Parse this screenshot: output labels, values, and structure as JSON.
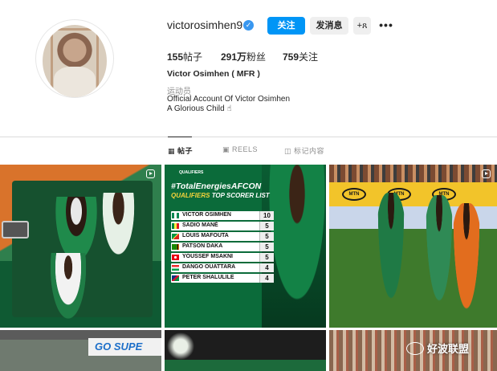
{
  "profile": {
    "username": "victorosimhen9",
    "verified": true,
    "follow_label": "关注",
    "message_label": "发消息",
    "add_user_label": "+ጸ",
    "more_label": "•••",
    "stats": {
      "posts_count": "155",
      "posts_label": "帖子",
      "followers_count": "291万",
      "followers_label": "粉丝",
      "following_count": "759",
      "following_label": "关注"
    },
    "full_name": "Victor Osimhen ( MFR )",
    "category": "运动员",
    "bio_line1": "Official Account Of Victor Osimhen",
    "bio_line2": "A Glorious Child ☝"
  },
  "tabs": [
    {
      "label": "帖子",
      "icon": "grid-icon",
      "active": true
    },
    {
      "label": "REELS",
      "icon": "reels-icon",
      "active": false
    },
    {
      "label": "标记内容",
      "icon": "tagged-icon",
      "active": false
    }
  ],
  "posts": {
    "p2": {
      "small_text": "QUALIFIERS",
      "headline": "#TotalEnergiesAFCON",
      "subhead_yellow": "QUALIFIERS",
      "subhead_white": "TOP SCORER LIST",
      "scorers": [
        {
          "name": "VICTOR OSIMHEN",
          "goals": "10"
        },
        {
          "name": "SADIO MANÉ",
          "goals": "5"
        },
        {
          "name": "LOUIS MAFOUTA",
          "goals": "5"
        },
        {
          "name": "PATSON DAKA",
          "goals": "5"
        },
        {
          "name": "YOUSSEF MSAKNI",
          "goals": "5"
        },
        {
          "name": "DANGO OUATTARA",
          "goals": "4"
        },
        {
          "name": "PETER SHALULILE",
          "goals": "4"
        }
      ]
    },
    "p3": {
      "board_text": "MTN"
    },
    "p4": {
      "banner_text": "GO SUPE"
    }
  },
  "watermark": {
    "text": "好波联盟"
  },
  "colors": {
    "follow_blue": "#0095f6",
    "verified_blue": "#3897f0",
    "nigeria_green": "#0b6b3a",
    "mtn_yellow": "#f2c42a"
  }
}
